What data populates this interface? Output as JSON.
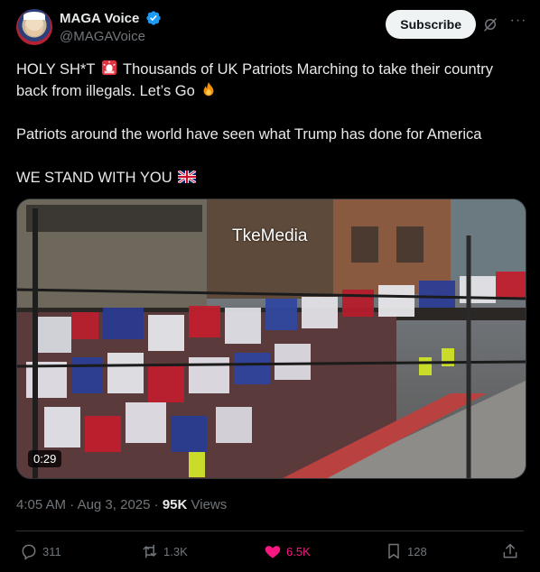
{
  "author": {
    "display_name": "MAGA Voice",
    "handle": "@MAGAVoice"
  },
  "header": {
    "subscribe_label": "Subscribe"
  },
  "tweet": {
    "line1_a": "HOLY SH*T",
    "line1_b": "Thousands of UK Patriots Marching to take their country back from illegals. Let’s Go",
    "line2": "Patriots around the world have seen what Trump has done for America",
    "line3": "WE STAND WITH YOU"
  },
  "media": {
    "watermark": "TkeMedia",
    "duration": "0:29"
  },
  "meta": {
    "time": "4:05 AM",
    "separator1": "·",
    "date": "Aug 3, 2025",
    "separator2": "·",
    "views_count": "95K",
    "views_label": "Views"
  },
  "actions": {
    "replies": "311",
    "reposts": "1.3K",
    "likes": "6.5K",
    "bookmarks": "128"
  },
  "colors": {
    "background": "#000000",
    "text": "#e7e9ea",
    "muted": "#71767b",
    "verified": "#1d9bf0",
    "like": "#f91880"
  }
}
